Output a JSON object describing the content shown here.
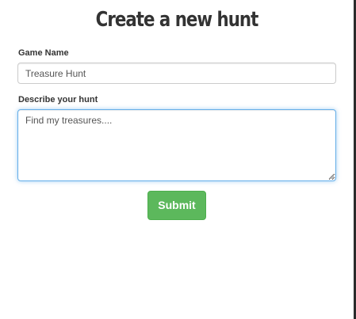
{
  "page": {
    "title": "Create a new hunt"
  },
  "form": {
    "game_name": {
      "label": "Game Name",
      "value": "Treasure Hunt"
    },
    "description": {
      "label": "Describe your hunt",
      "value": "Find my treasures....",
      "focused": true
    },
    "submit_label": "Submit"
  },
  "colors": {
    "submit_bg": "#5cb85c",
    "focus_border": "#66afe9",
    "right_border": "#2b2b2b"
  },
  "icons": {
    "textarea_resize": "resize-grip-icon"
  }
}
